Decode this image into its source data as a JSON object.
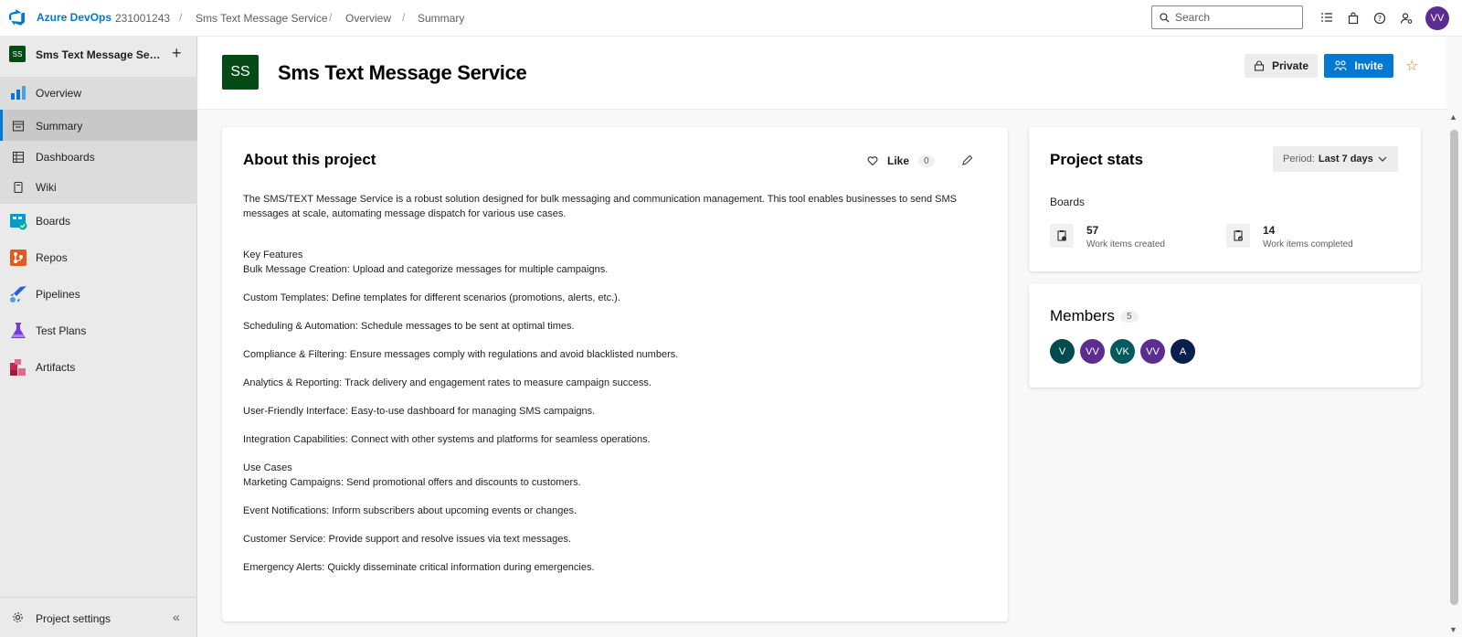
{
  "topbar": {
    "brand": "Azure DevOps",
    "org": "231001243",
    "breadcrumbs": [
      "Sms Text Message Service",
      "Overview",
      "Summary"
    ],
    "search_placeholder": "Search",
    "user_initials": "VV"
  },
  "sidebar": {
    "project_name": "Sms Text Message Service",
    "project_initials": "SS",
    "items": [
      {
        "label": "Overview"
      },
      {
        "label": "Summary"
      },
      {
        "label": "Dashboards"
      },
      {
        "label": "Wiki"
      },
      {
        "label": "Boards"
      },
      {
        "label": "Repos"
      },
      {
        "label": "Pipelines"
      },
      {
        "label": "Test Plans"
      },
      {
        "label": "Artifacts"
      }
    ],
    "settings_label": "Project settings"
  },
  "header": {
    "initials": "SS",
    "title": "Sms Text Message Service",
    "private_label": "Private",
    "invite_label": "Invite"
  },
  "about": {
    "title": "About this project",
    "like_label": "Like",
    "like_count": "0",
    "intro": "The SMS/TEXT Message Service is a robust solution designed for bulk messaging and communication management. This tool enables businesses to send SMS messages at scale, automating message dispatch for various use cases.",
    "key_features_heading": "Key Features",
    "features": [
      "Bulk Message Creation: Upload and categorize messages for multiple campaigns.",
      "Custom Templates: Define templates for different scenarios (promotions, alerts, etc.).",
      "Scheduling & Automation: Schedule messages to be sent at optimal times.",
      "Compliance & Filtering: Ensure messages comply with regulations and avoid blacklisted numbers.",
      "Analytics & Reporting: Track delivery and engagement rates to measure campaign success.",
      "User-Friendly Interface: Easy-to-use dashboard for managing SMS campaigns.",
      "Integration Capabilities: Connect with other systems and platforms for seamless operations."
    ],
    "use_cases_heading": "Use Cases",
    "use_cases": [
      "Marketing Campaigns: Send promotional offers and discounts to customers.",
      "Event Notifications: Inform subscribers about upcoming events or changes.",
      "Customer Service: Provide support and resolve issues via text messages.",
      "Emergency Alerts: Quickly disseminate critical information during emergencies."
    ]
  },
  "stats": {
    "title": "Project stats",
    "period_label": "Period:",
    "period_value": "Last 7 days",
    "boards_label": "Boards",
    "created_count": "57",
    "created_label": "Work items created",
    "completed_count": "14",
    "completed_label": "Work items completed"
  },
  "members": {
    "title": "Members",
    "count": "5",
    "avatars": [
      {
        "initials": "V",
        "color": "#004b50"
      },
      {
        "initials": "VV",
        "color": "#5c2d91"
      },
      {
        "initials": "VK",
        "color": "#005b5e"
      },
      {
        "initials": "VV",
        "color": "#5c2d91"
      },
      {
        "initials": "A",
        "color": "#0b1f4f"
      }
    ]
  },
  "colors": {
    "accent": "#0078d4",
    "project_badge": "#054b16"
  }
}
